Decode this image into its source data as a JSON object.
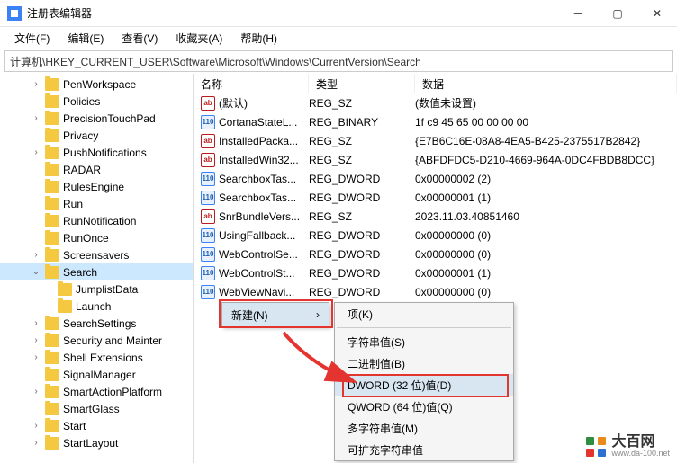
{
  "window": {
    "title": "注册表编辑器"
  },
  "menubar": [
    "文件(F)",
    "编辑(E)",
    "查看(V)",
    "收藏夹(A)",
    "帮助(H)"
  ],
  "path": "计算机\\HKEY_CURRENT_USER\\Software\\Microsoft\\Windows\\CurrentVersion\\Search",
  "tree": [
    {
      "d": 2,
      "chev": ">",
      "label": "PenWorkspace"
    },
    {
      "d": 2,
      "chev": "",
      "label": "Policies"
    },
    {
      "d": 2,
      "chev": ">",
      "label": "PrecisionTouchPad"
    },
    {
      "d": 2,
      "chev": "",
      "label": "Privacy"
    },
    {
      "d": 2,
      "chev": ">",
      "label": "PushNotifications"
    },
    {
      "d": 2,
      "chev": "",
      "label": "RADAR"
    },
    {
      "d": 2,
      "chev": "",
      "label": "RulesEngine"
    },
    {
      "d": 2,
      "chev": "",
      "label": "Run"
    },
    {
      "d": 2,
      "chev": "",
      "label": "RunNotification"
    },
    {
      "d": 2,
      "chev": "",
      "label": "RunOnce"
    },
    {
      "d": 2,
      "chev": ">",
      "label": "Screensavers"
    },
    {
      "d": 2,
      "chev": "v",
      "label": "Search",
      "sel": true
    },
    {
      "d": 3,
      "chev": "",
      "label": "JumplistData"
    },
    {
      "d": 3,
      "chev": "",
      "label": "Launch"
    },
    {
      "d": 2,
      "chev": ">",
      "label": "SearchSettings"
    },
    {
      "d": 2,
      "chev": ">",
      "label": "Security and Mainter"
    },
    {
      "d": 2,
      "chev": ">",
      "label": "Shell Extensions"
    },
    {
      "d": 2,
      "chev": "",
      "label": "SignalManager"
    },
    {
      "d": 2,
      "chev": ">",
      "label": "SmartActionPlatform"
    },
    {
      "d": 2,
      "chev": "",
      "label": "SmartGlass"
    },
    {
      "d": 2,
      "chev": ">",
      "label": "Start"
    },
    {
      "d": 2,
      "chev": ">",
      "label": "StartLayout"
    }
  ],
  "columns": {
    "name": "名称",
    "type": "类型",
    "data": "数据"
  },
  "values": [
    {
      "icon": "sz",
      "name": "(默认)",
      "type": "REG_SZ",
      "data": "(数值未设置)"
    },
    {
      "icon": "dw",
      "name": "CortanaStateL...",
      "type": "REG_BINARY",
      "data": "1f c9 45 65 00 00 00 00"
    },
    {
      "icon": "sz",
      "name": "InstalledPacka...",
      "type": "REG_SZ",
      "data": "{E7B6C16E-08A8-4EA5-B425-2375517B2842}"
    },
    {
      "icon": "sz",
      "name": "InstalledWin32...",
      "type": "REG_SZ",
      "data": "{ABFDFDC5-D210-4669-964A-0DC4FBDB8DCC}"
    },
    {
      "icon": "dw",
      "name": "SearchboxTas...",
      "type": "REG_DWORD",
      "data": "0x00000002 (2)"
    },
    {
      "icon": "dw",
      "name": "SearchboxTas...",
      "type": "REG_DWORD",
      "data": "0x00000001 (1)"
    },
    {
      "icon": "sz",
      "name": "SnrBundleVers...",
      "type": "REG_SZ",
      "data": "2023.11.03.40851460"
    },
    {
      "icon": "dw",
      "name": "UsingFallback...",
      "type": "REG_DWORD",
      "data": "0x00000000 (0)"
    },
    {
      "icon": "dw",
      "name": "WebControlSe...",
      "type": "REG_DWORD",
      "data": "0x00000000 (0)"
    },
    {
      "icon": "dw",
      "name": "WebControlSt...",
      "type": "REG_DWORD",
      "data": "0x00000001 (1)"
    },
    {
      "icon": "dw",
      "name": "WebViewNavi...",
      "type": "REG_DWORD",
      "data": "0x00000000 (0)"
    }
  ],
  "context": {
    "new_label": "新建(N)",
    "arrow": "›",
    "sub": [
      {
        "label": "项(K)"
      },
      {
        "sep": true
      },
      {
        "label": "字符串值(S)"
      },
      {
        "label": "二进制值(B)"
      },
      {
        "label": "DWORD (32 位)值(D)",
        "hl": true
      },
      {
        "label": "QWORD (64 位)值(Q)"
      },
      {
        "label": "多字符串值(M)"
      },
      {
        "label": "可扩充字符串值"
      }
    ]
  },
  "watermark": {
    "big": "大百网",
    "small": "www.da-100.net"
  }
}
